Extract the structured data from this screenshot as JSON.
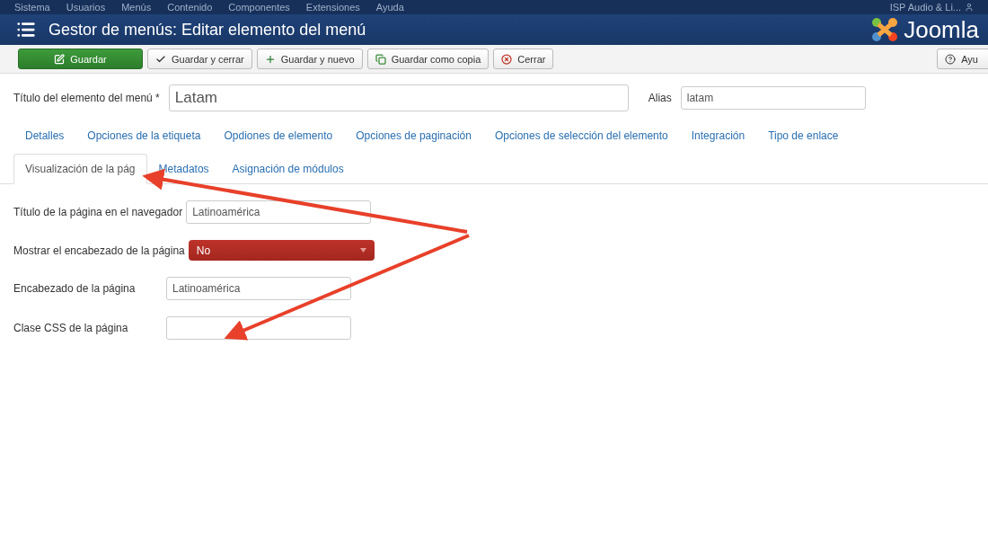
{
  "top_menu": {
    "items": [
      "Sistema",
      "Usuarios",
      "Menús",
      "Contenido",
      "Componentes",
      "Extensiones",
      "Ayuda"
    ],
    "user": "ISP Audio & Li..."
  },
  "header": {
    "title": "Gestor de menús: Editar elemento del menú",
    "logo": "Joomla"
  },
  "toolbar": {
    "buttons": [
      {
        "label": "Guardar",
        "kind": "primary"
      },
      {
        "label": "Guardar y cerrar",
        "kind": "default"
      },
      {
        "label": "Guardar y nuevo",
        "kind": "default"
      },
      {
        "label": "Guardar como copia",
        "kind": "default"
      },
      {
        "label": "Cerrar",
        "kind": "default"
      }
    ],
    "help": "Ayu"
  },
  "title_field": {
    "label": "Título del elemento del menú *",
    "value": "Latam"
  },
  "alias_field": {
    "label": "Alias",
    "value": "latam"
  },
  "tabs": [
    {
      "label": "Detalles",
      "selected": false
    },
    {
      "label": "Opciones de la etiqueta",
      "selected": false
    },
    {
      "label": "Opdiones de elemento",
      "selected": false
    },
    {
      "label": "Opciones de paginación",
      "selected": false
    },
    {
      "label": "Opciones de selección del elemento",
      "selected": false
    },
    {
      "label": "Integración",
      "selected": false
    },
    {
      "label": "Tipo de enlace",
      "selected": false
    },
    {
      "label": "Visualización de la pág",
      "selected": true
    },
    {
      "label": "Metadatos",
      "selected": false
    },
    {
      "label": "Asignación de módulos",
      "selected": false
    }
  ],
  "fields": [
    {
      "kind": "text",
      "label": "Título de la página en el navegador",
      "value": "Latinoamérica"
    },
    {
      "kind": "select",
      "label": "Mostrar el encabezado de la página",
      "value": "No"
    },
    {
      "kind": "text",
      "label": "Encabezado de la página",
      "value": "Latinoamérica"
    },
    {
      "kind": "text",
      "label": "Clase CSS de la página"
    }
  ]
}
